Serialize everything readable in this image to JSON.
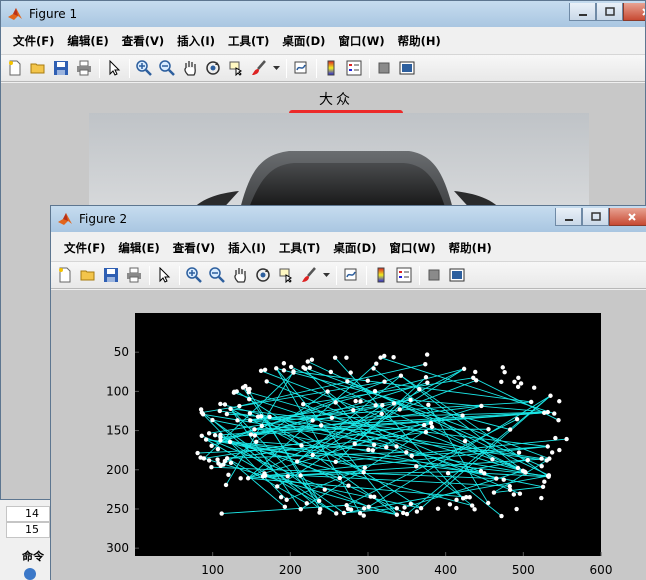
{
  "figure1": {
    "title": "Figure 1",
    "menus": [
      "文件(F)",
      "编辑(E)",
      "查看(V)",
      "插入(I)",
      "工具(T)",
      "桌面(D)",
      "窗口(W)",
      "帮助(H)"
    ],
    "plot_title": "大众",
    "annotation_color": "#ec2a2a"
  },
  "figure2": {
    "title": "Figure 2",
    "menus": [
      "文件(F)",
      "编辑(E)",
      "查看(V)",
      "插入(I)",
      "工具(T)",
      "桌面(D)",
      "窗口(W)",
      "帮助(H)"
    ],
    "plot": {
      "x_ticks": [
        "100",
        "200",
        "300",
        "400",
        "500",
        "600"
      ],
      "y_ticks": [
        "50",
        "100",
        "150",
        "200",
        "250",
        "300"
      ],
      "background": "#000000",
      "point_color": "#ffffff",
      "line_color": "#1ae6e6"
    }
  },
  "background_window": {
    "rows": [
      "14",
      "15"
    ],
    "panel_label": "命令"
  },
  "icons": {
    "toolbar": [
      "new-file-icon",
      "open-folder-icon",
      "save-icon",
      "print-icon",
      "pointer-icon",
      "zoom-in-icon",
      "zoom-out-icon",
      "pan-icon",
      "rotate-3d-icon",
      "data-cursor-icon",
      "brush-icon",
      "link-plot-icon",
      "colorbar-icon",
      "legend-icon",
      "hide-plot-tools-icon",
      "show-plot-tools-icon"
    ]
  }
}
